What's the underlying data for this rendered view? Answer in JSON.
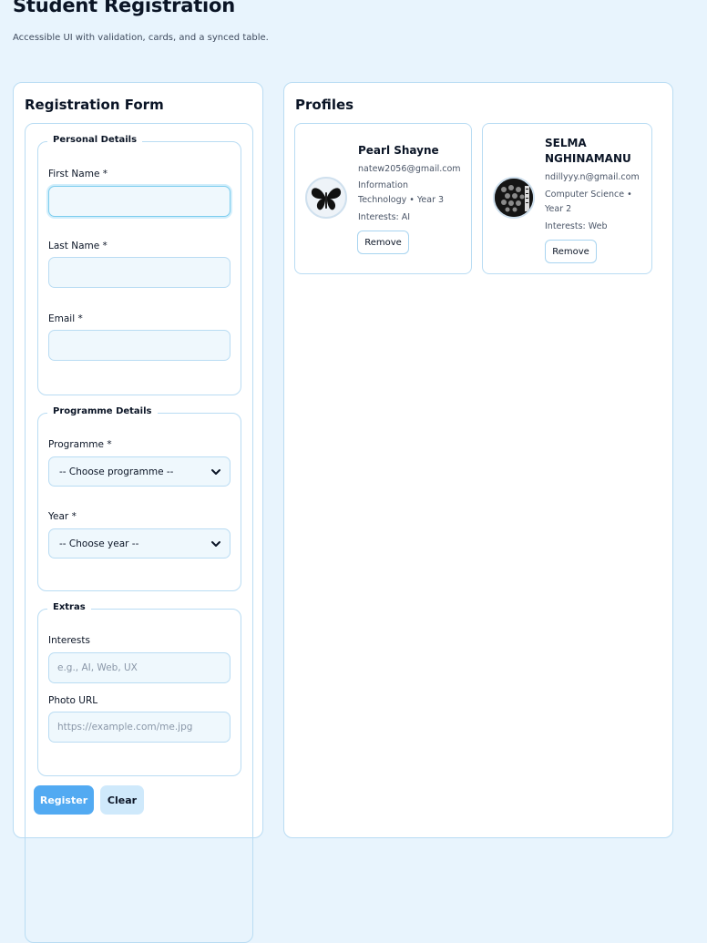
{
  "page": {
    "title": "Student Registration",
    "subtitle": "Accessible UI with validation, cards, and a synced table."
  },
  "form": {
    "title": "Registration Form",
    "personal": {
      "legend": "Personal Details",
      "first_name_label": "First Name *",
      "first_name_value": "",
      "last_name_label": "Last Name *",
      "last_name_value": "",
      "email_label": "Email *",
      "email_value": ""
    },
    "programme": {
      "legend": "Programme Details",
      "programme_label": "Programme *",
      "programme_selected": "-- Choose programme --",
      "year_label": "Year *",
      "year_selected": "-- Choose year --"
    },
    "extras": {
      "legend": "Extras",
      "interests_label": "Interests",
      "interests_placeholder": "e.g., AI, Web, UX",
      "photo_label": "Photo URL",
      "photo_placeholder": "https://example.com/me.jpg"
    },
    "register_label": "Register",
    "clear_label": "Clear"
  },
  "profiles": {
    "title": "Profiles",
    "items": [
      {
        "name": "Pearl Shayne",
        "email": "natew2056@gmail.com",
        "programme_line1": "Information",
        "programme_line2": "Technology • Year 3",
        "interests": "Interests: AI",
        "remove_label": "Remove",
        "avatar": "butterfly-icon"
      },
      {
        "name_line1": "SELMA",
        "name_line2": "NGHINAMANU",
        "email": "ndillyyy.n@gmail.com",
        "programme_line1": "Computer Science •",
        "programme_line2": "Year 2",
        "interests": "Interests: Web",
        "remove_label": "Remove",
        "avatar": "photo-avatar"
      }
    ]
  },
  "colors": {
    "background": "#e8f4fd",
    "border": "#b9dcf3",
    "primary": "#52aaf2",
    "secondary": "#cfe9fb"
  }
}
